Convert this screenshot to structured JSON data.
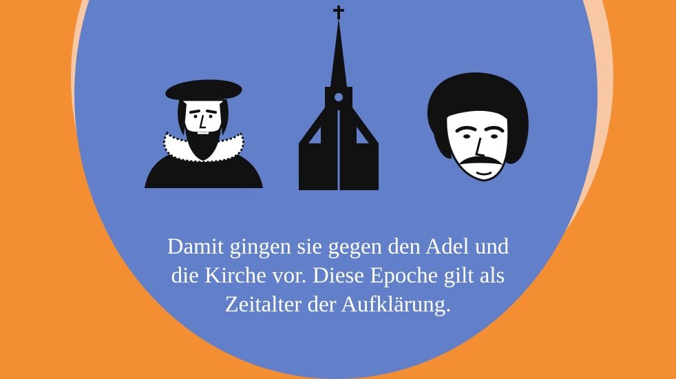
{
  "colors": {
    "background": "#F48E32",
    "ring": "#F7C8A3",
    "disc": "#6180C9",
    "icon": "#111111",
    "text": "#FFFFFF"
  },
  "icons": [
    "scholar-portrait-icon",
    "church-icon",
    "writer-portrait-icon"
  ],
  "caption": {
    "line1": "Damit gingen sie gegen den Adel und",
    "line2": "die Kirche vor. Diese Epoche gilt als",
    "line3": "Zeitalter der Aufklärung."
  }
}
